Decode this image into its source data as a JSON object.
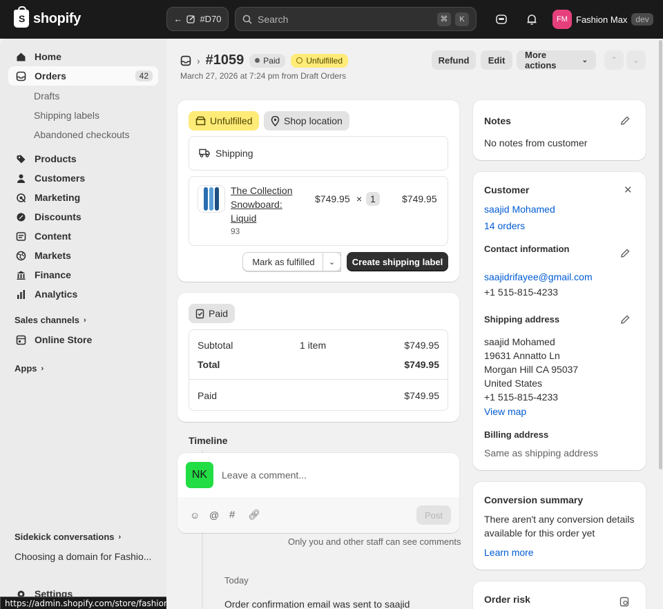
{
  "topbar": {
    "logo_text": "shopify",
    "back_label": "#D70",
    "search_placeholder": "Search",
    "shortcut_keys": [
      "⌘",
      "K"
    ],
    "store_initials": "FM",
    "store_name": "Fashion Max",
    "env_badge": "dev"
  },
  "sidebar": {
    "items": [
      {
        "label": "Home",
        "icon": "home-icon"
      },
      {
        "label": "Orders",
        "icon": "inbox-icon",
        "badge": "42"
      },
      {
        "label": "Products",
        "icon": "tag-icon"
      },
      {
        "label": "Customers",
        "icon": "person-icon"
      },
      {
        "label": "Marketing",
        "icon": "target-icon"
      },
      {
        "label": "Discounts",
        "icon": "discount-icon"
      },
      {
        "label": "Content",
        "icon": "content-icon"
      },
      {
        "label": "Markets",
        "icon": "globe-icon"
      },
      {
        "label": "Finance",
        "icon": "bank-icon"
      },
      {
        "label": "Analytics",
        "icon": "chart-icon"
      }
    ],
    "order_subitems": [
      "Drafts",
      "Shipping labels",
      "Abandoned checkouts"
    ],
    "sales_channels_label": "Sales channels",
    "online_store_label": "Online Store",
    "apps_label": "Apps",
    "sidekick_label": "Sidekick conversations",
    "sidekick_item": "Choosing a domain for Fashio...",
    "settings_label": "Settings",
    "status_url": "https://admin.shopify.com/store/fashion-max-2931"
  },
  "order": {
    "number": "#1059",
    "payment_status": "Paid",
    "fulfillment_status": "Unfulfilled",
    "subtitle": "March 27, 2026 at 7:24 pm from Draft Orders",
    "actions": {
      "refund": "Refund",
      "edit": "Edit",
      "more": "More actions"
    }
  },
  "fulfillment_card": {
    "status": "Unfulfilled",
    "location": "Shop location",
    "method": "Shipping",
    "item": {
      "name_lines": [
        "The Collection",
        "Snowboard:",
        "Liquid"
      ],
      "sku": "93",
      "price": "$749.95",
      "times": "×",
      "qty": "1",
      "total": "$749.95"
    },
    "mark_fulfilled": "Mark as fulfilled",
    "create_label": "Create shipping label"
  },
  "payment_card": {
    "status": "Paid",
    "subtotal_label": "Subtotal",
    "subtotal_items": "1 item",
    "subtotal_value": "$749.95",
    "total_label": "Total",
    "total_value": "$749.95",
    "paid_label": "Paid",
    "paid_value": "$749.95"
  },
  "timeline": {
    "title": "Timeline",
    "avatar_initials": "NK",
    "comment_placeholder": "Leave a comment...",
    "post_label": "Post",
    "staff_note": "Only you and other staff can see comments",
    "date_label": "Today",
    "event": "Order confirmation email was sent to saajid"
  },
  "notes": {
    "title": "Notes",
    "text": "No notes from customer"
  },
  "customer": {
    "title": "Customer",
    "name": "saajid Mohamed",
    "orders": "14 orders",
    "contact_title": "Contact information",
    "email": "saajidrifayee@gmail.com",
    "phone": "+1 515-815-4233",
    "shipping_title": "Shipping address",
    "address_lines": [
      "saajid Mohamed",
      "19631 Annatto Ln",
      "Morgan Hill CA 95037",
      "United States",
      "+1 515-815-4233"
    ],
    "view_map": "View map",
    "billing_title": "Billing address",
    "billing_text": "Same as shipping address"
  },
  "conversion": {
    "title": "Conversion summary",
    "text_lines": [
      "There aren't any conversion details",
      "available for this order yet"
    ],
    "learn_more": "Learn more"
  },
  "order_risk": {
    "title": "Order risk"
  },
  "colors": {
    "accent_link": "#005bd3",
    "unfulfilled_bg": "#ffeb78",
    "avatar_nk": "#22dd44",
    "avatar_fm": "#e6407c"
  }
}
